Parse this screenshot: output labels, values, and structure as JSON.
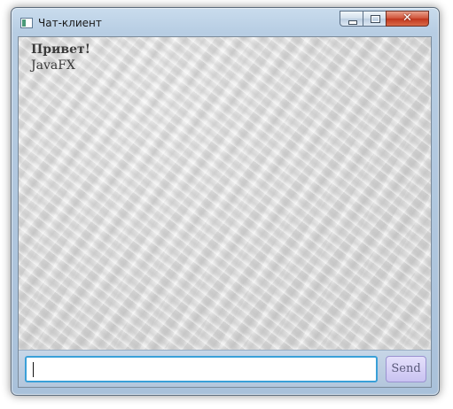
{
  "window": {
    "title": "Чат-клиент",
    "close_glyph": "✕"
  },
  "chat": {
    "messages": [
      "Привет!",
      "JavaFX"
    ]
  },
  "composer": {
    "input_value": "",
    "send_label": "Send"
  },
  "icons": {
    "app": "app-window-icon",
    "minimize": "minimize-icon",
    "maximize": "maximize-icon",
    "close": "close-icon"
  },
  "colors": {
    "input_focus_border": "#3aa0d8",
    "send_button_fill": "#c9c2f1",
    "close_button": "#c1361d",
    "frame": "#b7cde3"
  }
}
